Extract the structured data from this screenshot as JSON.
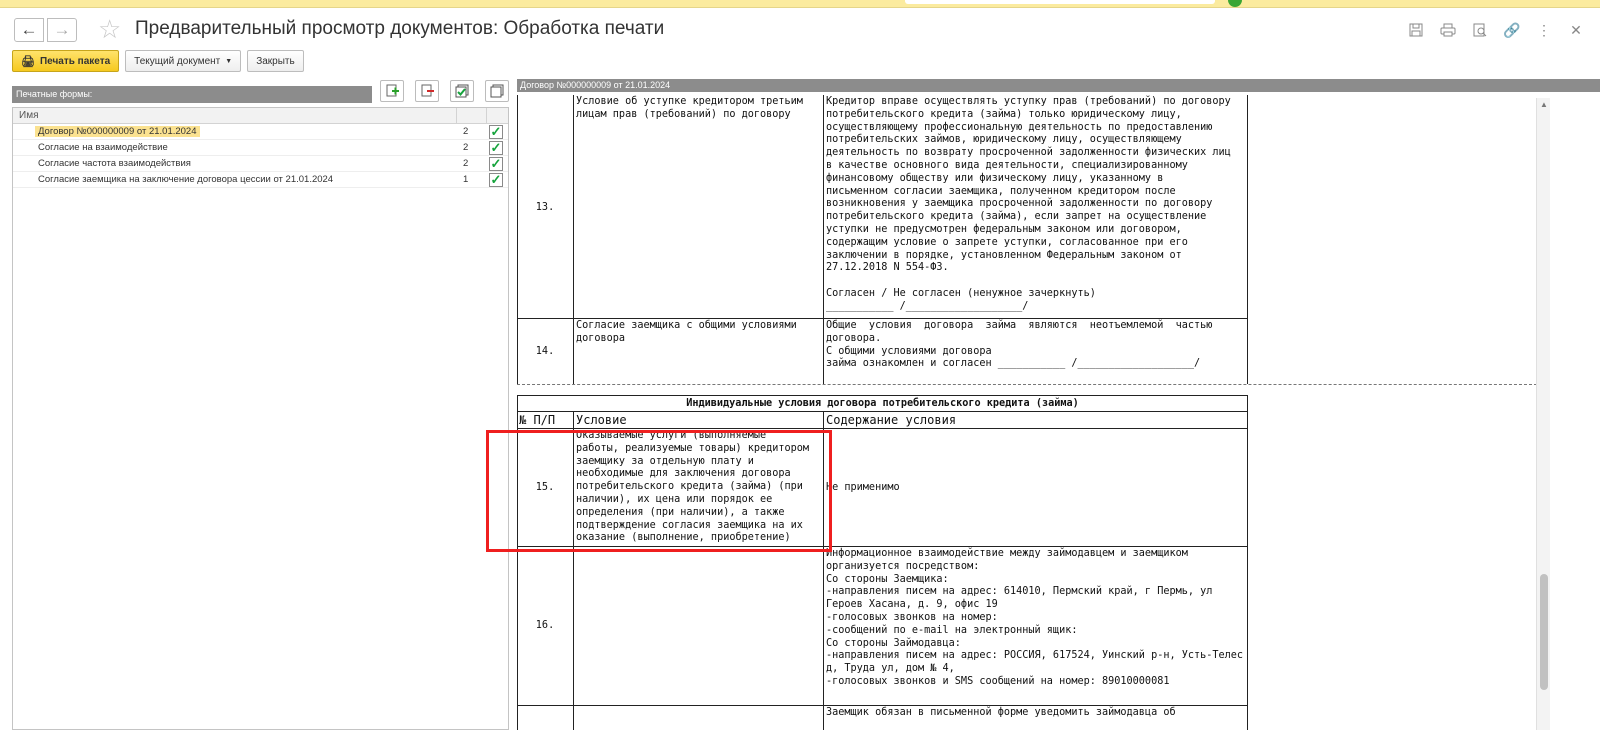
{
  "window": {
    "title": "Предварительный просмотр документов: Обработка печати"
  },
  "toolbar": {
    "print_package": "Печать пакета",
    "current_document": "Текущий документ",
    "close": "Закрыть"
  },
  "left": {
    "header": "Печатные формы:",
    "column_name": "Имя",
    "rows": [
      {
        "name": "Договор №000000009 от 21.01.2024",
        "qty": "2",
        "checked": true
      },
      {
        "name": "Согласие на взаимодействие",
        "qty": "2",
        "checked": true
      },
      {
        "name": "Согласие частота взаимодействия",
        "qty": "2",
        "checked": true
      },
      {
        "name": "Согласие заемщика на заключение договора цессии от 21.01.2024",
        "qty": "1",
        "checked": true
      }
    ]
  },
  "right": {
    "header": "Договор №000000009 от 21.01.2024"
  },
  "document": {
    "r13": {
      "num": "13.",
      "condition": "Условие об уступке кредитором третьим\nлицам прав (требований) по договору",
      "content": "Кредитор вправе осуществлять уступку прав (требований) по договору\nпотребительского кредита (займа) только юридическому лицу,\nосуществляющему профессиональную деятельность по предоставлению\nпотребительских займов, юридическому лицу, осуществляющему\nдеятельность по возврату просроченной задолженности физических лиц\nв качестве основного вида деятельности, специализированному\nфинансовому обществу или физическому лицу, указанному в\nписьменном согласии заемщика, полученном кредитором после\nвозникновения у заемщика просроченной задолженности по договору\nпотребительского кредита (займа), если запрет на осуществление\nуступки не предусмотрен федеральным законом или договором,\nсодержащим условие о запрете уступки, согласованное при его\nзаключении в порядке, установленном Федеральным законом от\n27.12.2018 N 554-ФЗ.\n\nСогласен / Не согласен (ненужное зачеркнуть)\n___________ /___________________/"
    },
    "r14": {
      "num": "14.",
      "condition": "Согласие заемщика с общими условиями\nдоговора",
      "content": "Общие  условия  договора  займа  являются  неотъемлемой  частью\nдоговора.\nС общими условиями договора\nзайма ознакомлен и согласен ___________ /___________________/"
    },
    "section_title": "Индивидуальные условия договора потребительского кредита (займа)",
    "col_num": "№ П/П",
    "col_condition": "Условие",
    "col_content": "Содержание условия",
    "r15": {
      "num": "15.",
      "condition": "Оказываемые услуги (выполняемые\nработы, реализуемые товары) кредитором\nзаемщику за отдельную плату и\nнеобходимые для заключения договора\nпотребительского кредита (займа) (при\nналичии), их цена или порядок ее\nопределения (при наличии), а также\nподтверждение согласия заемщика на их\nоказание (выполнение, приобретение)",
      "content": "Не применимо"
    },
    "r16": {
      "num": "16.",
      "content": "Информационное взаимодействие между займодавцем и заемщиком\nорганизуется посредством:\nСо стороны Заемщика:\n-направления писем на адрес: 614010, Пермский край, г Пермь, ул\nГероев Хасана, д. 9, офис 19\n-голосовых звонков на номер:\n-сообщений по e-mail на электронный ящик:\nСо стороны Займодавца:\n-направления писем на адрес: РОССИЯ, 617524, Уинский р-н, Усть-Телес\nд, Труда ул, дом № 4,\n-голосовых звонков и SMS сообщений на номер: 89010000081"
    },
    "r17": {
      "content_partial": "Заемщик обязан в письменной форме уведомить займодавца об"
    }
  },
  "icons": {
    "back": "arrow-left-icon",
    "forward": "arrow-right-icon",
    "favorite": "star-icon",
    "save": "save-icon",
    "print": "printer-icon",
    "preview": "preview-icon",
    "link": "link-icon",
    "more": "more-vertical-icon",
    "close": "close-icon"
  },
  "colors": {
    "primary_button": "#f6c91f",
    "selected_row": "#fbe290",
    "highlight_frame": "#ef1f1f",
    "checkmark": "#15a33c",
    "panel_header": "#8c8c8c"
  }
}
